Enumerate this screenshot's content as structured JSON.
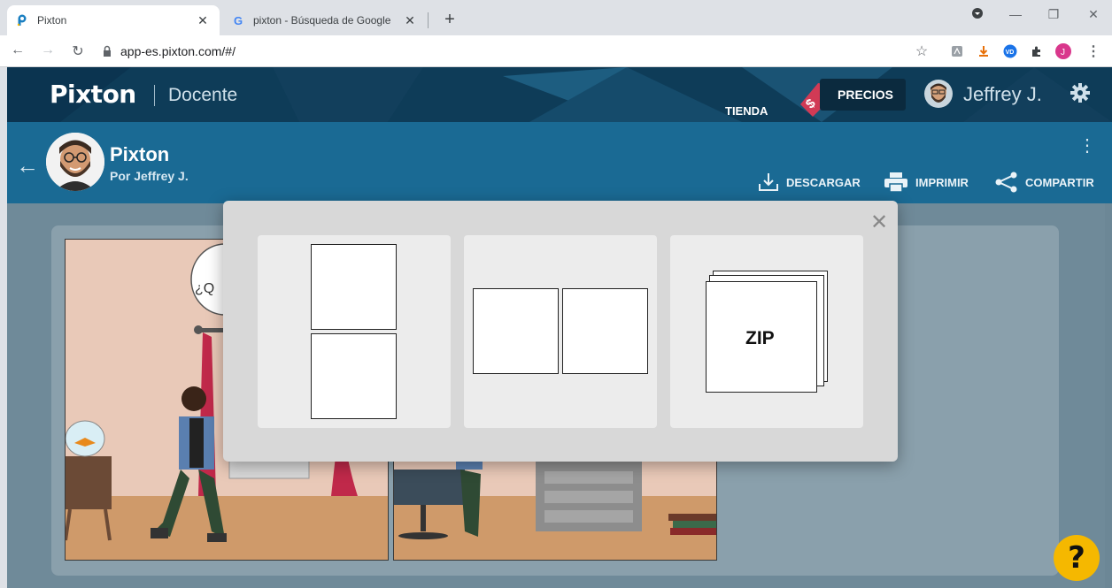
{
  "browser": {
    "tabs": [
      {
        "title": "Pixton",
        "active": true
      },
      {
        "title": "pixton - Búsqueda de Google",
        "active": false
      }
    ],
    "url": "app-es.pixton.com/#/"
  },
  "app": {
    "brand": "Pixton",
    "role": "Docente",
    "store_label": "TIENDA",
    "pricing_label": "PRECIOS",
    "user_name": "Jeffrey J.",
    "comic": {
      "title": "Pixton",
      "author": "Por Jeffrey J."
    },
    "actions": {
      "download": "DESCARGAR",
      "print": "IMPRIMIR",
      "share": "COMPARTIR"
    },
    "speech_bubble_text": "¿Q",
    "help_label": "?"
  },
  "download_modal": {
    "options": [
      {
        "id": "vertical-pages",
        "label": ""
      },
      {
        "id": "horizontal-pages",
        "label": ""
      },
      {
        "id": "zip-archive",
        "label": "ZIP"
      }
    ]
  },
  "colors": {
    "topbar": "#0e3c58",
    "subbar": "#1a6a94",
    "help": "#f5b800",
    "price_tag": "#d13a55"
  }
}
